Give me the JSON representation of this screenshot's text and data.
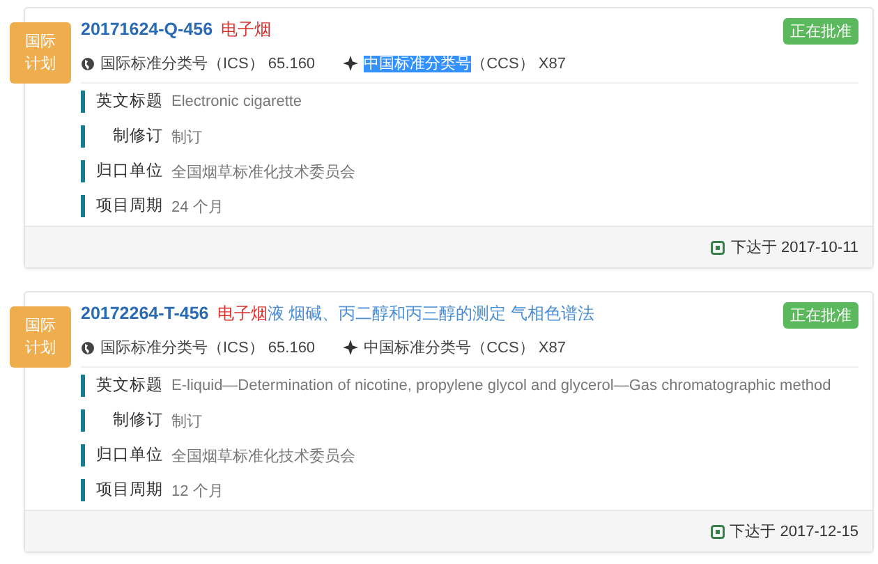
{
  "cards": [
    {
      "badge": [
        "国际",
        "计划"
      ],
      "number": "20171624-Q-456",
      "title_parts": [
        {
          "text": "电子烟",
          "highlight": true
        }
      ],
      "status": "正在批准",
      "classifications": [
        {
          "kind": "ics",
          "name": "国际标准分类号",
          "code": "（ICS）",
          "value": "65.160",
          "selected": false
        },
        {
          "kind": "ccs",
          "name": "中国标准分类号",
          "code": "（CCS）",
          "value": "X87",
          "selected": true
        }
      ],
      "fields": [
        {
          "label": "英文标题",
          "value": "Electronic cigarette"
        },
        {
          "label": "制修订",
          "value": "制订"
        },
        {
          "label": "归口单位",
          "value": "全国烟草标准化技术委员会"
        },
        {
          "label": "项目周期",
          "value": "24 个月"
        }
      ],
      "issued": "下达于 2017-10-11"
    },
    {
      "badge": [
        "国际",
        "计划"
      ],
      "number": "20172264-T-456",
      "title_parts": [
        {
          "text": "电子烟",
          "highlight": true
        },
        {
          "text": "液 烟碱、丙二醇和丙三醇的测定 气相色谱法",
          "highlight": false
        }
      ],
      "status": "正在批准",
      "classifications": [
        {
          "kind": "ics",
          "name": "国际标准分类号",
          "code": "（ICS）",
          "value": "65.160",
          "selected": false
        },
        {
          "kind": "ccs",
          "name": "中国标准分类号",
          "code": "（CCS）",
          "value": "X87",
          "selected": false
        }
      ],
      "fields": [
        {
          "label": "英文标题",
          "value": "E-liquid—Determination of nicotine, propylene glycol and glycerol—Gas chromatographic method"
        },
        {
          "label": "制修订",
          "value": "制订"
        },
        {
          "label": "归口单位",
          "value": "全国烟草标准化技术委员会"
        },
        {
          "label": "项目周期",
          "value": "12 个月"
        }
      ],
      "issued": "下达于 2017-12-15"
    }
  ]
}
